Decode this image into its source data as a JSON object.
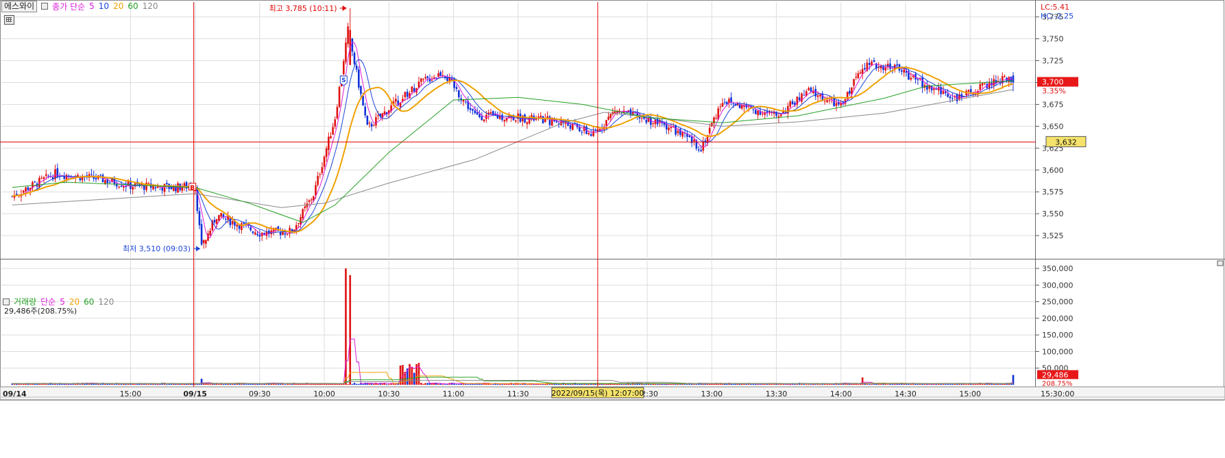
{
  "header": {
    "stock_name": "에스와이",
    "price_legend_label": "종가 단순",
    "ma_periods": [
      "5",
      "10",
      "20",
      "60",
      "120"
    ],
    "ma_colors": [
      "#d81bd8",
      "#1a44d8",
      "#f0a000",
      "#23a023",
      "#888888"
    ]
  },
  "right_top": {
    "lc": "LC:5.41",
    "hc": "HC:-2.25"
  },
  "price_panel": {
    "y_ticks": [
      3775,
      3750,
      3725,
      3700,
      3675,
      3650,
      3625,
      3600,
      3575,
      3550,
      3525
    ],
    "y_tick_labels": [
      "3,775",
      "3,750",
      "3,725",
      "3,700",
      "3,675",
      "3,650",
      "3,625",
      "3,600",
      "3,575",
      "3,550",
      "3,525"
    ],
    "current_price": 3700,
    "current_price_label": "3,700",
    "current_change_label": "3.35%",
    "crosshair_price": 3632,
    "crosshair_price_label": "3,632",
    "high_label": "최고 3,785 (10:11)",
    "low_label": "최저 3,510 (09:03)",
    "marker_s": "S",
    "marker_b": "B"
  },
  "volume_panel": {
    "title": "거래량",
    "ma_label": "단순",
    "ma_periods": [
      "5",
      "20",
      "60",
      "120"
    ],
    "readout": "29,486주(208.75%)",
    "y_ticks": [
      350000,
      300000,
      250000,
      200000,
      150000,
      100000,
      50000
    ],
    "y_tick_labels": [
      "350,000",
      "300,000",
      "250,000",
      "200,000",
      "150,000",
      "100,000",
      "50,000"
    ],
    "current_volume": 29486,
    "current_volume_label": "29,486",
    "current_pct_label": "208.75%"
  },
  "x_axis": {
    "labels": [
      "09/14",
      "15:00",
      "09/15",
      "09:30",
      "10:00",
      "10:30",
      "11:00",
      "11:30",
      "12:30",
      "13:00",
      "13:30",
      "14:00",
      "14:30",
      "15:00",
      "15:30:00"
    ],
    "crosshair_time_label": "2022/09/15(목) 12:07:00"
  },
  "chart_data": {
    "type": "candlestick",
    "title": "에스와이",
    "price_axis": {
      "ylim": [
        3500,
        3792
      ]
    },
    "volume_axis": {
      "ylim": [
        0,
        375000
      ]
    },
    "key_points": [
      {
        "x": "09/14 14:05",
        "y": 3570
      },
      {
        "x": "09/14 14:25",
        "y": 3596
      },
      {
        "x": "09/14 14:45",
        "y": 3590
      },
      {
        "x": "09/14 15:00",
        "y": 3582
      },
      {
        "x": "09/14 15:20",
        "y": 3580
      },
      {
        "x": "09/15 09:00",
        "y": 3582
      },
      {
        "x": "09/15 09:03",
        "y": 3510
      },
      {
        "x": "09/15 09:10",
        "y": 3548
      },
      {
        "x": "09/15 09:30",
        "y": 3528
      },
      {
        "x": "09/15 09:45",
        "y": 3530
      },
      {
        "x": "09/15 09:55",
        "y": 3572
      },
      {
        "x": "09/15 10:05",
        "y": 3660
      },
      {
        "x": "09/15 10:11",
        "y": 3760
      },
      {
        "x": "09/15 10:20",
        "y": 3648
      },
      {
        "x": "09/15 10:30",
        "y": 3670
      },
      {
        "x": "09/15 10:45",
        "y": 3700
      },
      {
        "x": "09/15 10:55",
        "y": 3712
      },
      {
        "x": "09/15 11:10",
        "y": 3662
      },
      {
        "x": "09/15 11:30",
        "y": 3660
      },
      {
        "x": "09/15 11:50",
        "y": 3655
      },
      {
        "x": "09/15 12:05",
        "y": 3640
      },
      {
        "x": "09/15 12:15",
        "y": 3668
      },
      {
        "x": "09/15 12:40",
        "y": 3650
      },
      {
        "x": "09/15 12:55",
        "y": 3625
      },
      {
        "x": "09/15 13:05",
        "y": 3680
      },
      {
        "x": "09/15 13:15",
        "y": 3672
      },
      {
        "x": "09/15 13:30",
        "y": 3662
      },
      {
        "x": "09/15 13:45",
        "y": 3690
      },
      {
        "x": "09/15 14:00",
        "y": 3672
      },
      {
        "x": "09/15 14:10",
        "y": 3720
      },
      {
        "x": "09/15 14:25",
        "y": 3718
      },
      {
        "x": "09/15 14:40",
        "y": 3695
      },
      {
        "x": "09/15 14:55",
        "y": 3682
      },
      {
        "x": "09/15 15:10",
        "y": 3700
      },
      {
        "x": "09/15 15:18",
        "y": 3705
      },
      {
        "x": "09/15 15:20",
        "y": 3700
      }
    ],
    "ma_lines": [
      {
        "name": "120",
        "color": "#888888",
        "points": [
          {
            "x": "09/14 14:05",
            "y": 3560
          },
          {
            "x": "09/15 09:00",
            "y": 3573
          },
          {
            "x": "09/15 09:40",
            "y": 3557
          },
          {
            "x": "09/15 10:00",
            "y": 3562
          },
          {
            "x": "09/15 10:30",
            "y": 3585
          },
          {
            "x": "09/15 11:10",
            "y": 3612
          },
          {
            "x": "09/15 11:50",
            "y": 3653
          },
          {
            "x": "09/15 12:10",
            "y": 3666
          },
          {
            "x": "09/15 12:40",
            "y": 3658
          },
          {
            "x": "09/15 13:05",
            "y": 3650
          },
          {
            "x": "09/15 13:40",
            "y": 3655
          },
          {
            "x": "09/15 14:20",
            "y": 3665
          },
          {
            "x": "09/15 15:20",
            "y": 3692
          }
        ]
      },
      {
        "name": "60",
        "color": "#23a023",
        "points": [
          {
            "x": "09/14 14:05",
            "y": 3580
          },
          {
            "x": "09/14 14:30",
            "y": 3586
          },
          {
            "x": "09/15 09:00",
            "y": 3580
          },
          {
            "x": "09/15 09:25",
            "y": 3562
          },
          {
            "x": "09/15 09:50",
            "y": 3540
          },
          {
            "x": "09/15 10:05",
            "y": 3560
          },
          {
            "x": "09/15 10:30",
            "y": 3620
          },
          {
            "x": "09/15 11:00",
            "y": 3680
          },
          {
            "x": "09/15 11:30",
            "y": 3683
          },
          {
            "x": "09/15 12:00",
            "y": 3675
          },
          {
            "x": "09/15 12:30",
            "y": 3660
          },
          {
            "x": "09/15 13:05",
            "y": 3654
          },
          {
            "x": "09/15 13:40",
            "y": 3662
          },
          {
            "x": "09/15 14:20",
            "y": 3682
          },
          {
            "x": "09/15 14:40",
            "y": 3696
          },
          {
            "x": "09/15 15:20",
            "y": 3702
          }
        ]
      }
    ],
    "volume_peaks": [
      {
        "x": "09/15 09:03",
        "y": 18000
      },
      {
        "x": "09/15 10:10",
        "y": 350000
      },
      {
        "x": "09/15 10:12",
        "y": 330000
      },
      {
        "x": "09/15 14:10",
        "y": 22000
      },
      {
        "x": "09/15 15:20",
        "y": 29486
      }
    ]
  }
}
